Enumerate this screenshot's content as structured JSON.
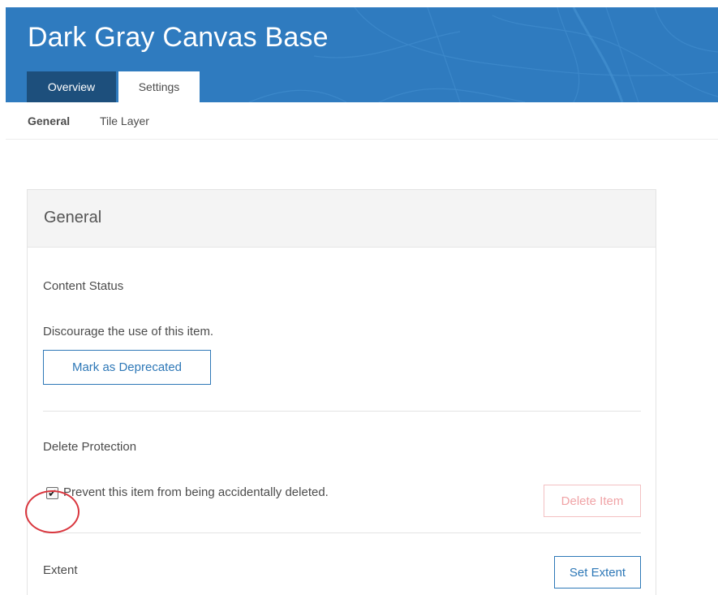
{
  "header": {
    "title": "Dark Gray Canvas Base",
    "tabs": [
      {
        "label": "Overview",
        "active": false
      },
      {
        "label": "Settings",
        "active": true
      }
    ],
    "colors": {
      "banner": "#2f7bbf",
      "active_tab_bg": "#ffffff",
      "inactive_tab_bg": "#1d4f7c"
    }
  },
  "subnav": {
    "items": [
      {
        "label": "General",
        "active": true
      },
      {
        "label": "Tile Layer",
        "active": false
      }
    ]
  },
  "panel": {
    "heading": "General",
    "content_status": {
      "title": "Content Status",
      "description": "Discourage the use of this item.",
      "button_label": "Mark as Deprecated"
    },
    "delete_protection": {
      "title": "Delete Protection",
      "checkbox_label": "Prevent this item from being accidentally deleted.",
      "checked": true,
      "check_glyph": "✔",
      "delete_button_label": "Delete Item"
    },
    "extent": {
      "title": "Extent",
      "button_label": "Set Extent"
    }
  },
  "colors": {
    "link_blue": "#2e78b7",
    "danger_light": "#f0a3a6",
    "highlight_circle": "#d9363e"
  }
}
